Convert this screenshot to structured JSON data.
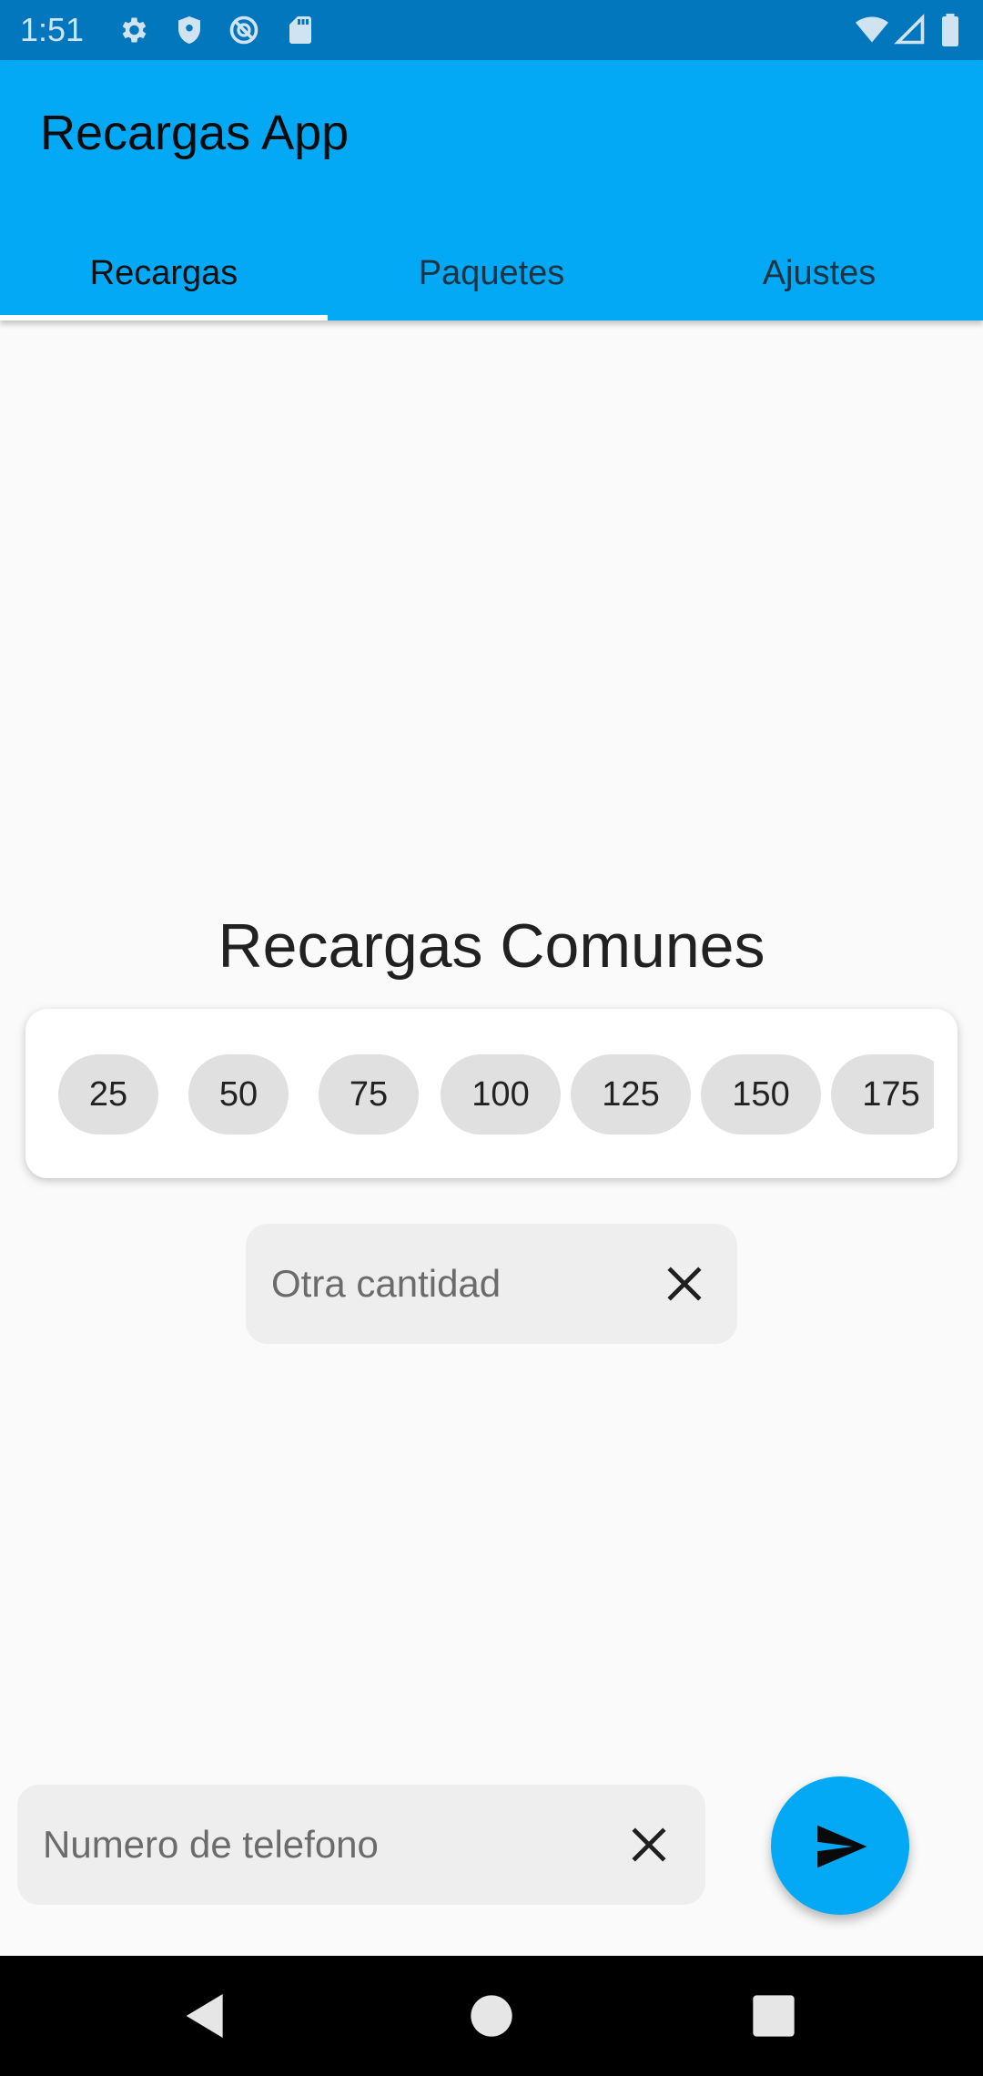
{
  "status_bar": {
    "time": "1:51",
    "left_icons": [
      "settings-icon",
      "shield-icon",
      "no-sim-icon",
      "sd-card-icon"
    ],
    "right_icons": [
      "wifi-icon",
      "signal-icon",
      "battery-icon"
    ]
  },
  "app_bar": {
    "title": "Recargas App",
    "tabs": [
      {
        "label": "Recargas",
        "active": true
      },
      {
        "label": "Paquetes",
        "active": false
      },
      {
        "label": "Ajustes",
        "active": false
      }
    ],
    "color": "#03a9f4"
  },
  "main": {
    "section_title": "Recargas Comunes",
    "amounts": [
      "25",
      "50",
      "75",
      "100",
      "125",
      "150",
      "175"
    ],
    "other_amount": {
      "placeholder": "Otra cantidad",
      "value": "",
      "clear_icon": "close-icon"
    }
  },
  "bottom": {
    "phone": {
      "placeholder": "Numero de telefono",
      "value": "",
      "clear_icon": "close-icon"
    },
    "send_icon": "send-icon"
  },
  "nav_bar": {
    "buttons": [
      "back-icon",
      "home-icon",
      "recents-icon"
    ]
  }
}
